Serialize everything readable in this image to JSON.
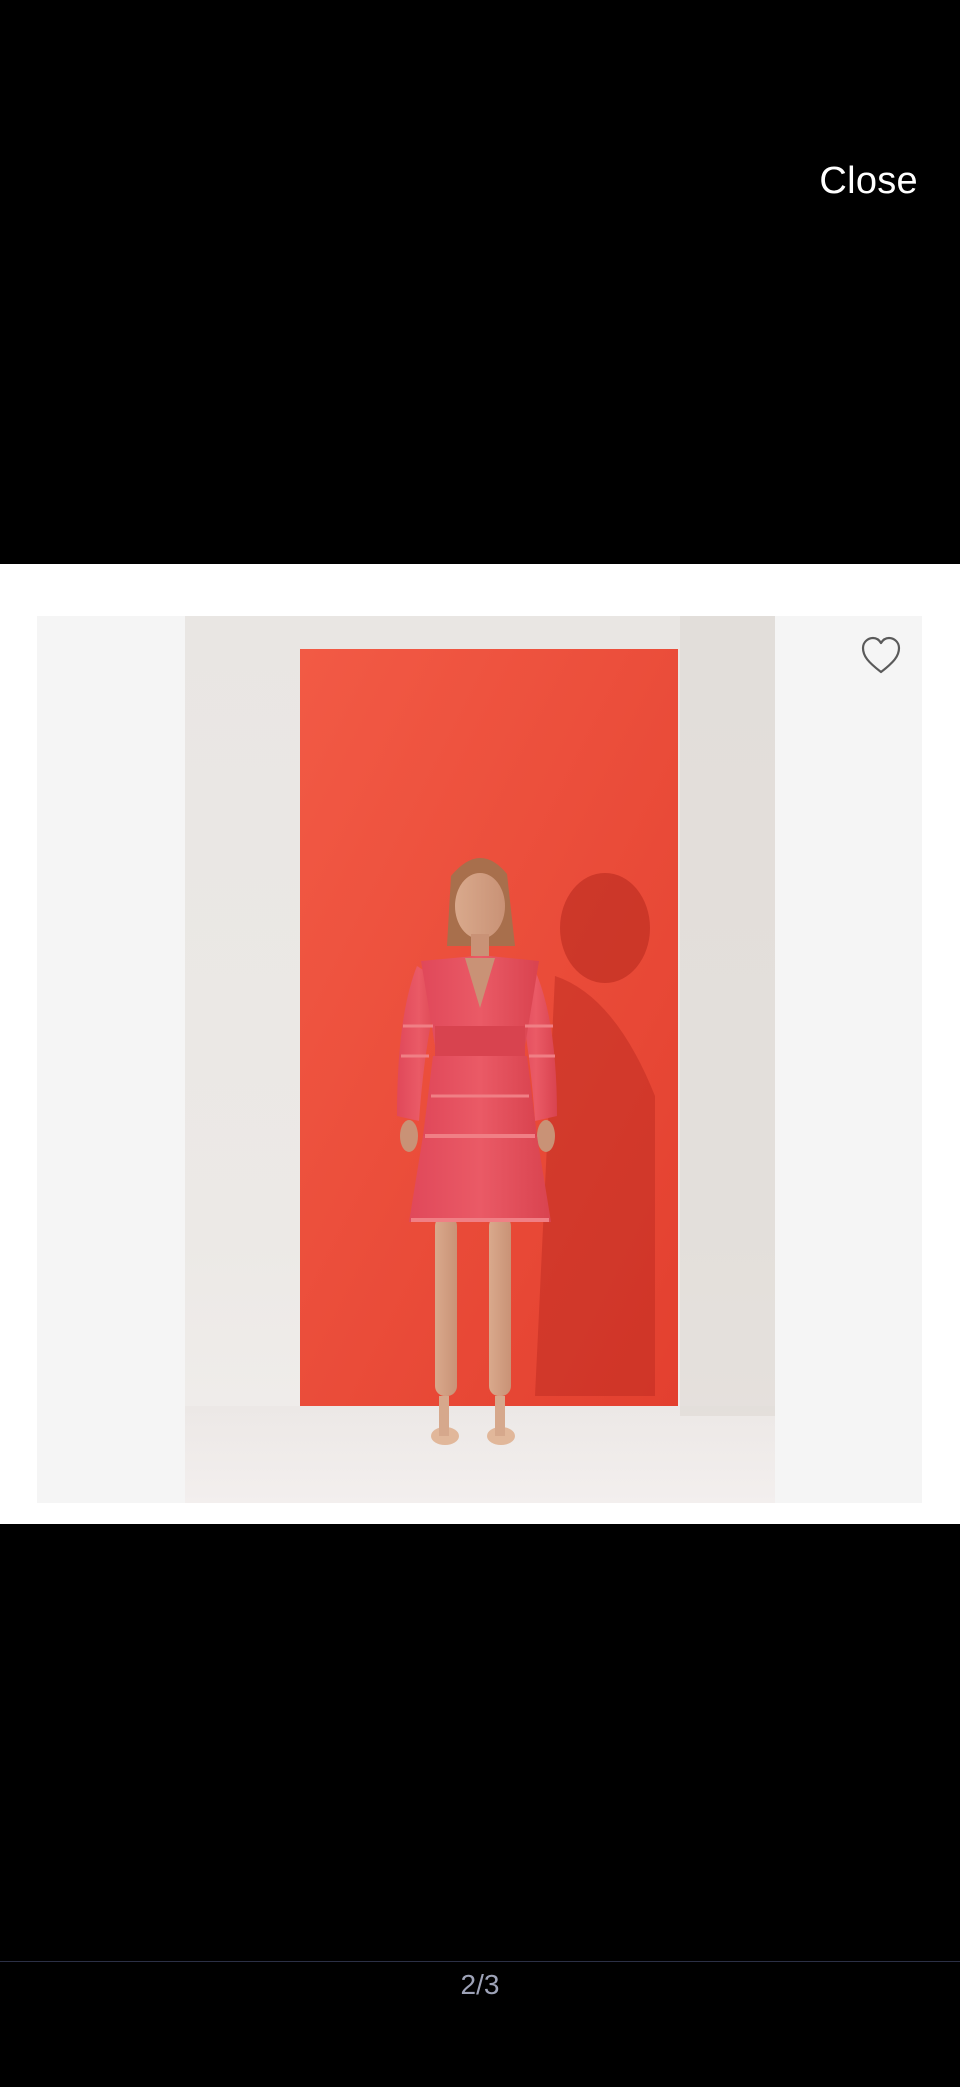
{
  "header": {
    "close_label": "Close"
  },
  "image": {
    "favorite_icon": "heart-outline-icon",
    "wall_color": "#ee4a36",
    "dress_color": "#e85560"
  },
  "pager": {
    "text": "2/3"
  }
}
